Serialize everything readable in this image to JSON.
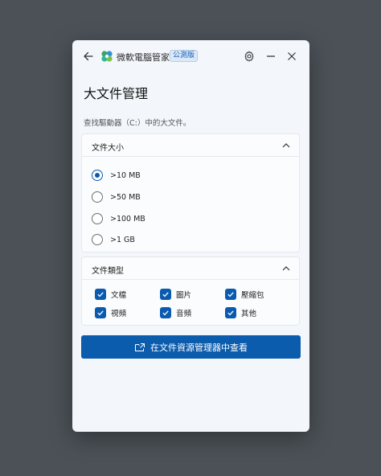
{
  "titlebar": {
    "app_name": "微軟電腦管家",
    "badge": "公測版"
  },
  "page": {
    "title": "大文件管理",
    "subtitle": "查找驅動器（C:）中的大文件。"
  },
  "size_section": {
    "title": "文件大小",
    "selected_index": 0,
    "options": [
      ">10 MB",
      ">50 MB",
      ">100 MB",
      ">1 GB"
    ]
  },
  "type_section": {
    "title": "文件類型",
    "items": [
      {
        "label": "文檔",
        "checked": true
      },
      {
        "label": "圖片",
        "checked": true
      },
      {
        "label": "壓縮包",
        "checked": true
      },
      {
        "label": "視頻",
        "checked": true
      },
      {
        "label": "音頻",
        "checked": true
      },
      {
        "label": "其他",
        "checked": true
      }
    ]
  },
  "action": {
    "label": "在文件資源管理器中查看"
  },
  "colors": {
    "accent": "#0b5cad",
    "background": "#4b5157",
    "window": "#f3f6fb"
  }
}
